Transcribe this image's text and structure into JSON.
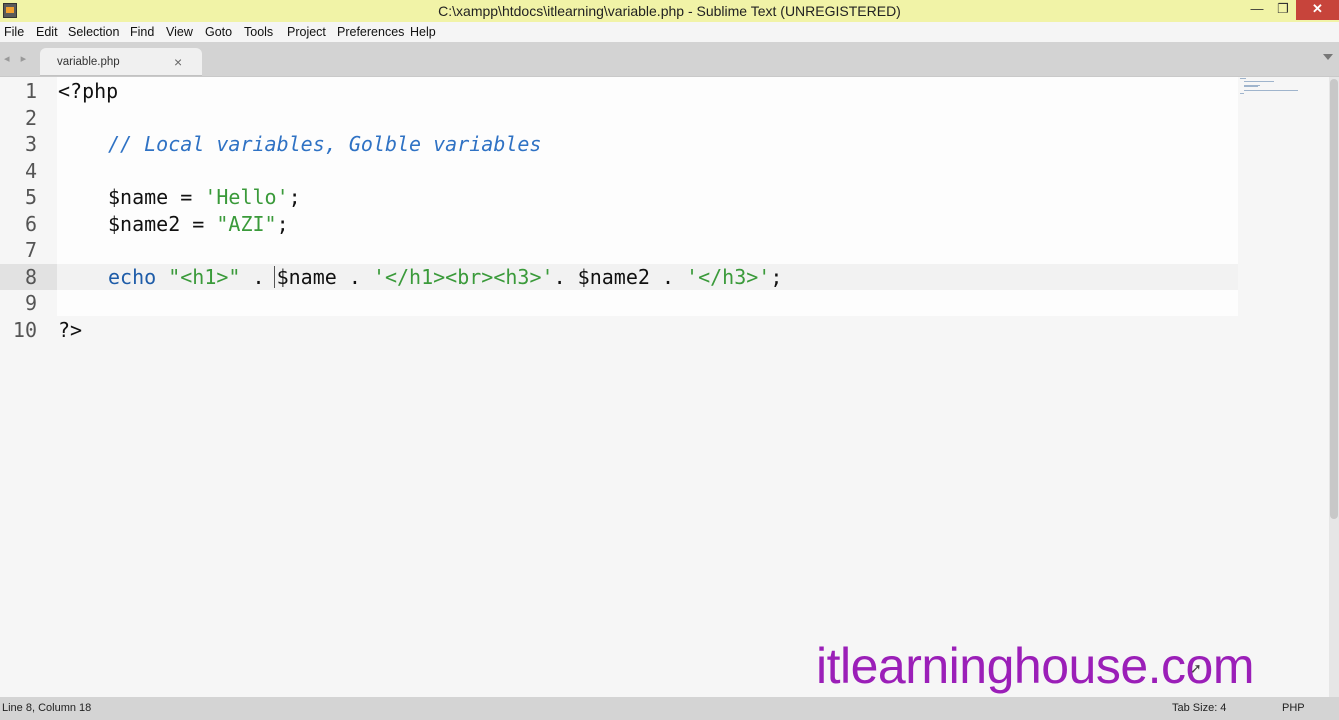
{
  "window": {
    "title": "C:\\xampp\\htdocs\\itlearning\\variable.php - Sublime Text (UNREGISTERED)",
    "min_label": "—",
    "max_label": "❐",
    "close_label": "✕"
  },
  "menu": [
    "File",
    "Edit",
    "Selection",
    "Find",
    "View",
    "Goto",
    "Tools",
    "Project",
    "Preferences",
    "Help"
  ],
  "tab": {
    "label": "variable.php",
    "close": "×",
    "nav_arrows": "◂ ▸"
  },
  "editor": {
    "line_numbers": [
      "1",
      "2",
      "3",
      "4",
      "5",
      "6",
      "7",
      "8",
      "9",
      "10"
    ],
    "active_line": 8,
    "lines": {
      "l1": "<?php",
      "l3": "// Local variables, Golble variables",
      "l5_var": "$name",
      "l5_eq": " = ",
      "l5_str": "'Hello'",
      "l5_end": ";",
      "l6_var": "$name2",
      "l6_eq": " = ",
      "l6_str": "\"AZI\"",
      "l6_end": ";",
      "l8_kw": "echo",
      "l8_s1": "\"<h1>\"",
      "l8_dot1": " . ",
      "l8_var1": "$name",
      "l8_dot2": " . ",
      "l8_s2": "'</h1><br><h3>'",
      "l8_dot3": ". ",
      "l8_var2": "$name2",
      "l8_dot4": " . ",
      "l8_s3": "'</h3>'",
      "l8_end": ";",
      "l10": "?>"
    }
  },
  "watermark": "itlearninghouse.com",
  "statusbar": {
    "position": "Line 8, Column 18",
    "tab_size": "Tab Size: 4",
    "syntax": "PHP"
  }
}
